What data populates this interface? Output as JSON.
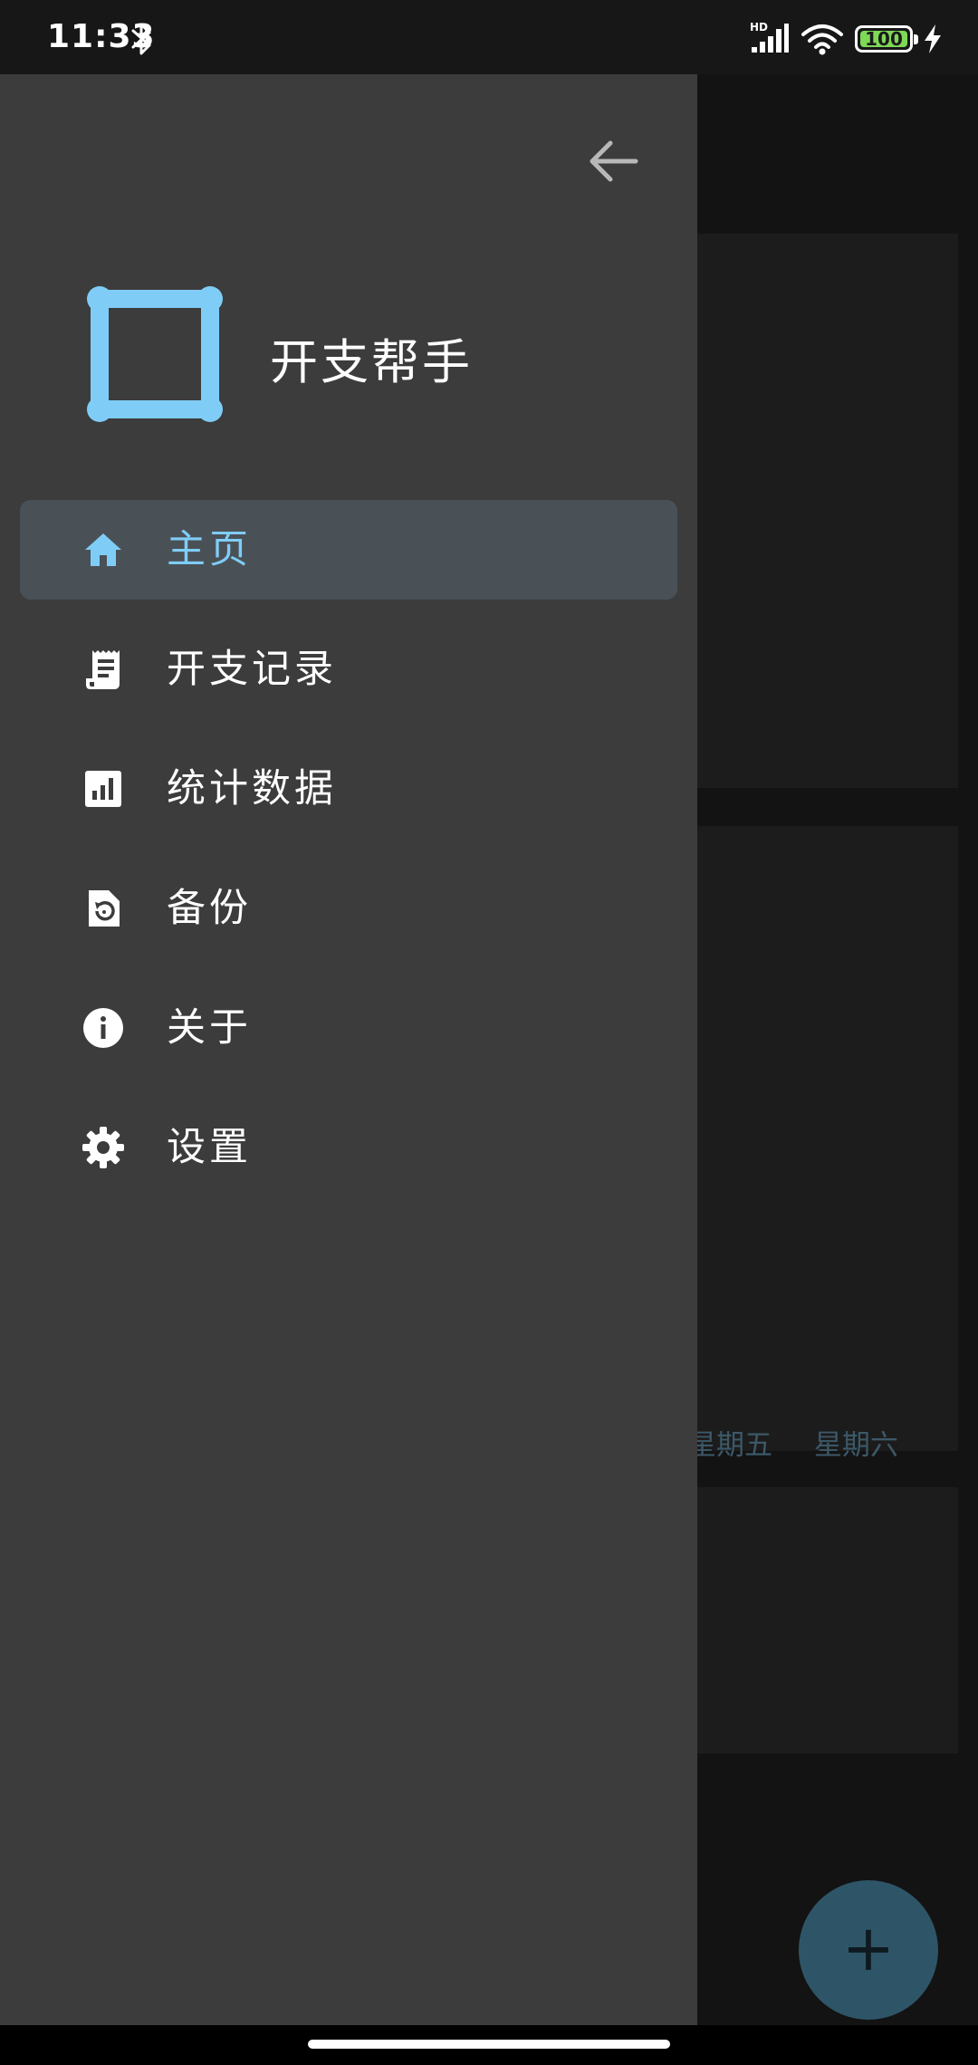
{
  "status_bar": {
    "time": "11:33",
    "network_badge": "HD",
    "battery_level": "100",
    "battery_fraction": 1.0,
    "battery_color": "#7ed957"
  },
  "drawer": {
    "back_icon": "arrow-left-icon",
    "app_logo_icon": "square-logo-icon",
    "app_name": "开支帮手",
    "accent_color": "#7fcdf7",
    "menu": [
      {
        "id": "home",
        "label": "主页",
        "icon": "home-icon",
        "active": true
      },
      {
        "id": "expense-records",
        "label": "开支记录",
        "icon": "receipt-icon",
        "active": false
      },
      {
        "id": "statistics",
        "label": "统计数据",
        "icon": "bar-chart-icon",
        "active": false
      },
      {
        "id": "backup",
        "label": "备份",
        "icon": "backup-file-icon",
        "active": false
      },
      {
        "id": "about",
        "label": "关于",
        "icon": "info-icon",
        "active": false
      },
      {
        "id": "settings",
        "label": "设置",
        "icon": "gear-icon",
        "active": false
      }
    ]
  },
  "background": {
    "weekdays": [
      "星期五",
      "星期六"
    ],
    "fab_label": "+",
    "fab_color": "#2e5567"
  }
}
